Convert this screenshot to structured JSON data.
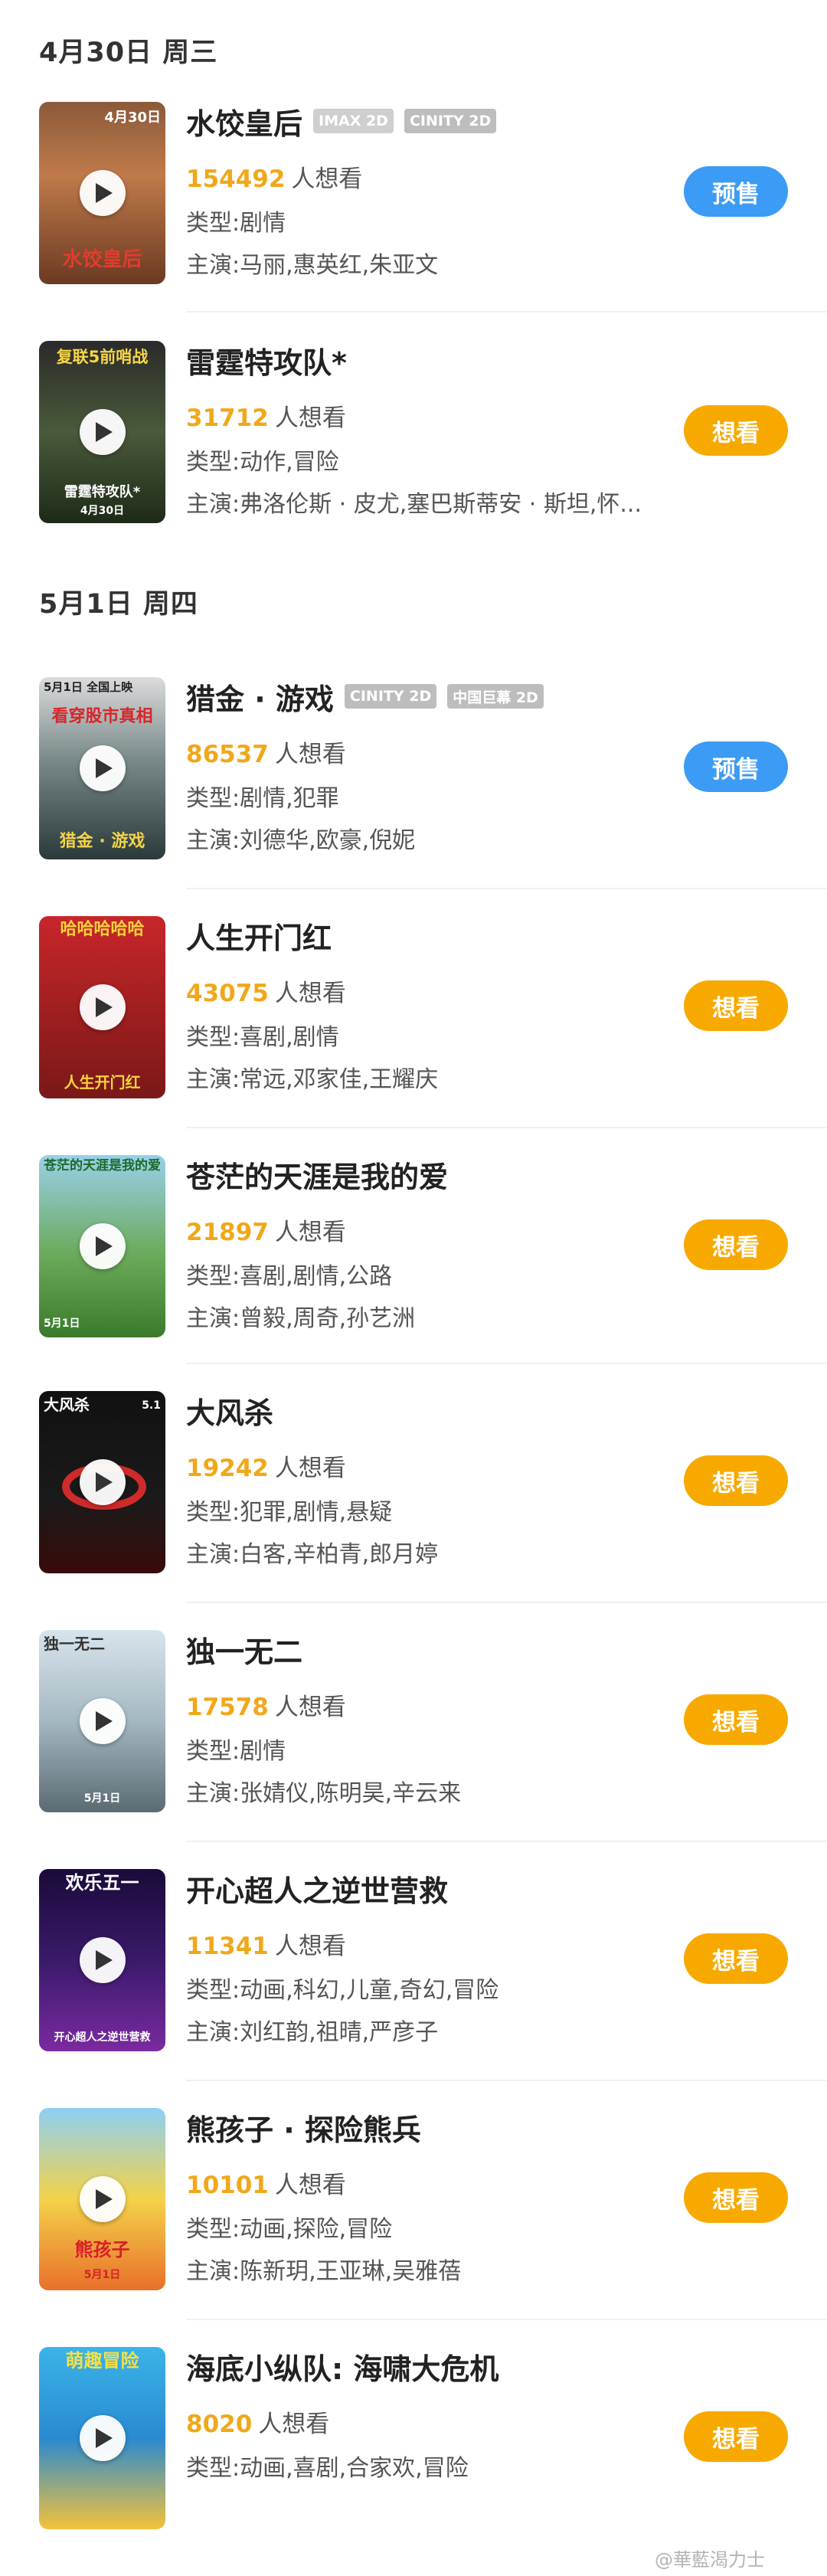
{
  "sections": [
    {
      "date": "4月30日 周三"
    },
    {
      "date": "5月1日 周四"
    }
  ],
  "colors": {
    "presale_button": "#3b9bf5",
    "want_button": "#f7a900",
    "want_count": "#f0a81a"
  },
  "want_suffix": "人想看",
  "movies": [
    {
      "title": "水饺皇后",
      "tags": [
        "IMAX 2D",
        "CINITY 2D"
      ],
      "wants": "154492",
      "genre": "类型:剧情",
      "cast": "主演:马丽,惠英红,朱亚文",
      "button": "预售",
      "poster_text": "水饺皇后",
      "poster_date": "4月30日"
    },
    {
      "title": "雷霆特攻队*",
      "tags": [],
      "wants": "31712",
      "genre": "类型:动作,冒险",
      "cast": "主演:弗洛伦斯 · 皮尤,塞巴斯蒂安 · 斯坦,怀...",
      "button": "想看",
      "poster_text": "复联5前哨战",
      "poster_date": "4月30日"
    },
    {
      "title": "猎金 · 游戏",
      "tags": [
        "CINITY 2D",
        "中国巨幕 2D"
      ],
      "wants": "86537",
      "genre": "类型:剧情,犯罪",
      "cast": "主演:刘德华,欧豪,倪妮",
      "button": "预售",
      "poster_text": "看穿股市真相",
      "poster_date": "5月1日 全国上映"
    },
    {
      "title": "人生开门红",
      "tags": [],
      "wants": "43075",
      "genre": "类型:喜剧,剧情",
      "cast": "主演:常远,邓家佳,王耀庆",
      "button": "想看",
      "poster_text": "哈哈哈哈哈",
      "poster_date": ""
    },
    {
      "title": "苍茫的天涯是我的爱",
      "tags": [],
      "wants": "21897",
      "genre": "类型:喜剧,剧情,公路",
      "cast": "主演:曾毅,周奇,孙艺洲",
      "button": "想看",
      "poster_text": "苍茫的天涯是我的爱",
      "poster_date": "5月1日"
    },
    {
      "title": "大风杀",
      "tags": [],
      "wants": "19242",
      "genre": "类型:犯罪,剧情,悬疑",
      "cast": "主演:白客,辛柏青,郎月婷",
      "button": "想看",
      "poster_text": "大风杀",
      "poster_date": "5.1"
    },
    {
      "title": "独一无二",
      "tags": [],
      "wants": "17578",
      "genre": "类型:剧情",
      "cast": "主演:张婧仪,陈明昊,辛云来",
      "button": "想看",
      "poster_text": "独一无二",
      "poster_date": "5月1日"
    },
    {
      "title": "开心超人之逆世营救",
      "tags": [],
      "wants": "11341",
      "genre": "类型:动画,科幻,儿童,奇幻,冒险",
      "cast": "主演:刘红韵,祖晴,严彦子",
      "button": "想看",
      "poster_text": "欢乐五一",
      "poster_date": ""
    },
    {
      "title": "熊孩子 · 探险熊兵",
      "tags": [],
      "wants": "10101",
      "genre": "类型:动画,探险,冒险",
      "cast": "主演:陈新玥,王亚琳,吴雅蓓",
      "button": "想看",
      "poster_text": "熊孩子",
      "poster_date": "5月1日"
    },
    {
      "title": "海底小纵队: 海啸大危机",
      "tags": [],
      "wants": "8020",
      "genre": "类型:动画,喜剧,合家欢,冒险",
      "cast": "",
      "button": "想看",
      "poster_text": "萌趣冒险",
      "poster_date": ""
    }
  ],
  "watermark": "@華藍渴力士"
}
